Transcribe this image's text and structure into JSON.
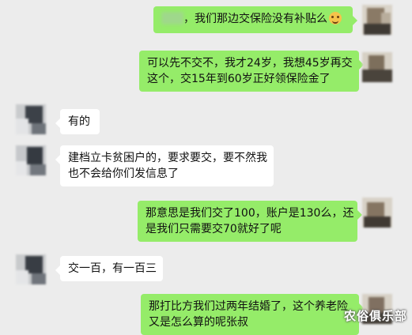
{
  "messages": [
    {
      "side": "out",
      "prefix_hidden": true,
      "text": "，我们那边交保险没有补贴么",
      "emoji": "crying-laugh-emoji"
    },
    {
      "side": "out",
      "lines": [
        "可以先不交不，我才24岁，我想45岁再交",
        "这个，交15年到60岁正好领保险金了"
      ]
    },
    {
      "side": "in",
      "lines": [
        "有的"
      ]
    },
    {
      "side": "in",
      "lines": [
        "建档立卡贫困户的，要求要交，要不然我",
        "也不会给你们发信息了"
      ]
    },
    {
      "side": "out",
      "lines": [
        "那意思是我们交了100，账户是130么，还",
        "是我们只需要交70就好了呢"
      ]
    },
    {
      "side": "in",
      "lines": [
        "交一百，有一百三"
      ]
    },
    {
      "side": "out",
      "lines": [
        "那打比方我们过两年结婚了，这个养老险",
        "又是怎么算的呢张叔"
      ]
    }
  ],
  "watermark": "农俗俱乐部",
  "colors": {
    "outgoing": "#95ec69",
    "incoming": "#ffffff",
    "background": "#ececec"
  }
}
